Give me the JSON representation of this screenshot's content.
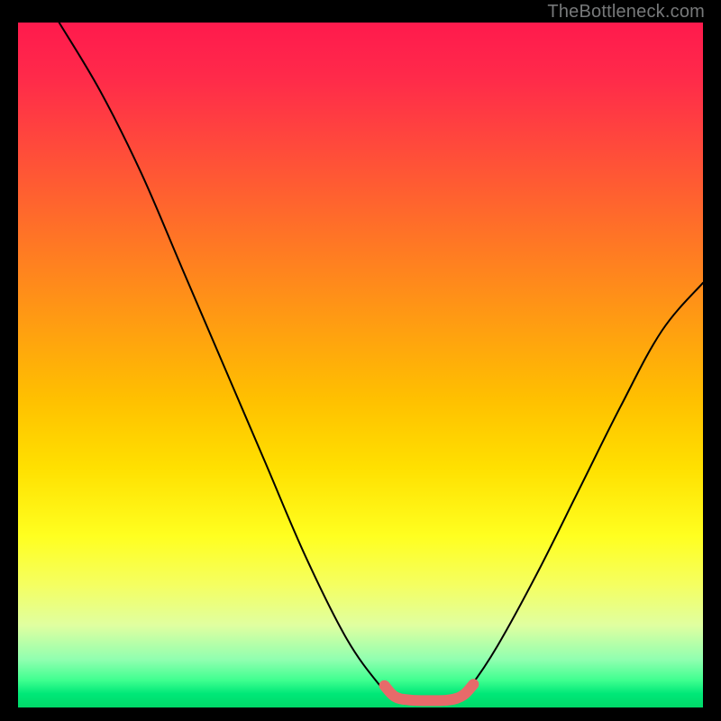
{
  "watermark": "TheBottleneck.com",
  "chart_data": {
    "type": "line",
    "title": "",
    "xlabel": "",
    "ylabel": "",
    "xlim": [
      0,
      100
    ],
    "ylim": [
      0,
      100
    ],
    "grid": false,
    "curve": {
      "name": "bottleneck-curve",
      "points_xy_pct": [
        [
          6,
          100
        ],
        [
          12,
          90
        ],
        [
          18,
          78
        ],
        [
          24,
          64
        ],
        [
          30,
          50
        ],
        [
          36,
          36
        ],
        [
          42,
          22
        ],
        [
          48,
          10
        ],
        [
          53,
          3
        ],
        [
          55,
          1.2
        ],
        [
          58,
          0.8
        ],
        [
          61,
          0.8
        ],
        [
          64,
          1.2
        ],
        [
          66,
          3
        ],
        [
          70,
          9
        ],
        [
          76,
          20
        ],
        [
          82,
          32
        ],
        [
          88,
          44
        ],
        [
          94,
          55
        ],
        [
          100,
          62
        ]
      ]
    },
    "highlight_segment": {
      "color": "#e76a6a",
      "points_xy_pct": [
        [
          53.5,
          3.2
        ],
        [
          55,
          1.6
        ],
        [
          57,
          1.1
        ],
        [
          60,
          1.0
        ],
        [
          63,
          1.1
        ],
        [
          65,
          1.8
        ],
        [
          66.5,
          3.4
        ]
      ]
    }
  }
}
